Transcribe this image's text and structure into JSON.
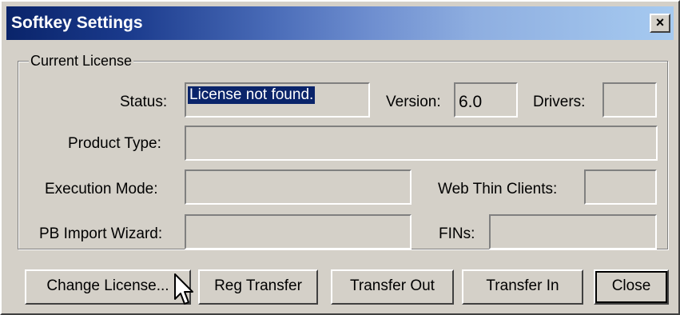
{
  "window": {
    "title": "Softkey Settings",
    "close_glyph": "×"
  },
  "group": {
    "legend": "Current License"
  },
  "fields": {
    "status_label": "Status:",
    "status_value": "License not found.",
    "version_label": "Version:",
    "version_value": "6.0",
    "drivers_label": "Drivers:",
    "drivers_value": "",
    "product_type_label": "Product Type:",
    "product_type_value": "",
    "execution_mode_label": "Execution Mode:",
    "execution_mode_value": "",
    "web_thin_clients_label": "Web Thin Clients:",
    "web_thin_clients_value": "",
    "pb_import_label": "PB Import Wizard:",
    "pb_import_value": "",
    "fins_label": "FINs:",
    "fins_value": ""
  },
  "buttons": {
    "change_license": "Change License...",
    "reg_transfer": "Reg Transfer",
    "transfer_out": "Transfer Out",
    "transfer_in": "Transfer In",
    "close": "Close"
  },
  "icons": {
    "cursor": "arrow-pointer-icon",
    "close": "close-icon"
  },
  "colors": {
    "title_bar_start": "#0a246a",
    "title_bar_end": "#a6caf0",
    "selection_bg": "#0a246a",
    "dialog_bg": "#d4d0c8"
  }
}
